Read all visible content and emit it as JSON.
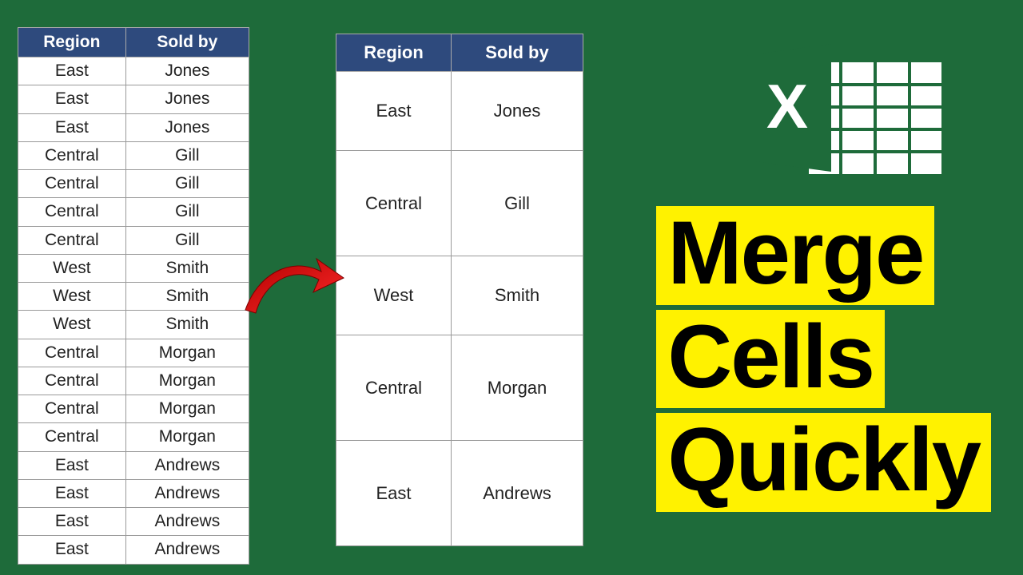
{
  "headers": {
    "region": "Region",
    "soldby": "Sold by"
  },
  "left_rows": [
    {
      "region": "East",
      "soldby": "Jones"
    },
    {
      "region": "East",
      "soldby": "Jones"
    },
    {
      "region": "East",
      "soldby": "Jones"
    },
    {
      "region": "Central",
      "soldby": "Gill"
    },
    {
      "region": "Central",
      "soldby": "Gill"
    },
    {
      "region": "Central",
      "soldby": "Gill"
    },
    {
      "region": "Central",
      "soldby": "Gill"
    },
    {
      "region": "West",
      "soldby": "Smith"
    },
    {
      "region": "West",
      "soldby": "Smith"
    },
    {
      "region": "West",
      "soldby": "Smith"
    },
    {
      "region": "Central",
      "soldby": "Morgan"
    },
    {
      "region": "Central",
      "soldby": "Morgan"
    },
    {
      "region": "Central",
      "soldby": "Morgan"
    },
    {
      "region": "Central",
      "soldby": "Morgan"
    },
    {
      "region": "East",
      "soldby": "Andrews"
    },
    {
      "region": "East",
      "soldby": "Andrews"
    },
    {
      "region": "East",
      "soldby": "Andrews"
    },
    {
      "region": "East",
      "soldby": "Andrews"
    }
  ],
  "right_rows": [
    {
      "region": "East",
      "soldby": "Jones",
      "span": 3
    },
    {
      "region": "Central",
      "soldby": "Gill",
      "span": 4
    },
    {
      "region": "West",
      "soldby": "Smith",
      "span": 3
    },
    {
      "region": "Central",
      "soldby": "Morgan",
      "span": 4
    },
    {
      "region": "East",
      "soldby": "Andrews",
      "span": 4
    }
  ],
  "title": {
    "line1": "Merge",
    "line2": "Cells",
    "line3": "Quickly"
  },
  "row_unit_height": 33
}
